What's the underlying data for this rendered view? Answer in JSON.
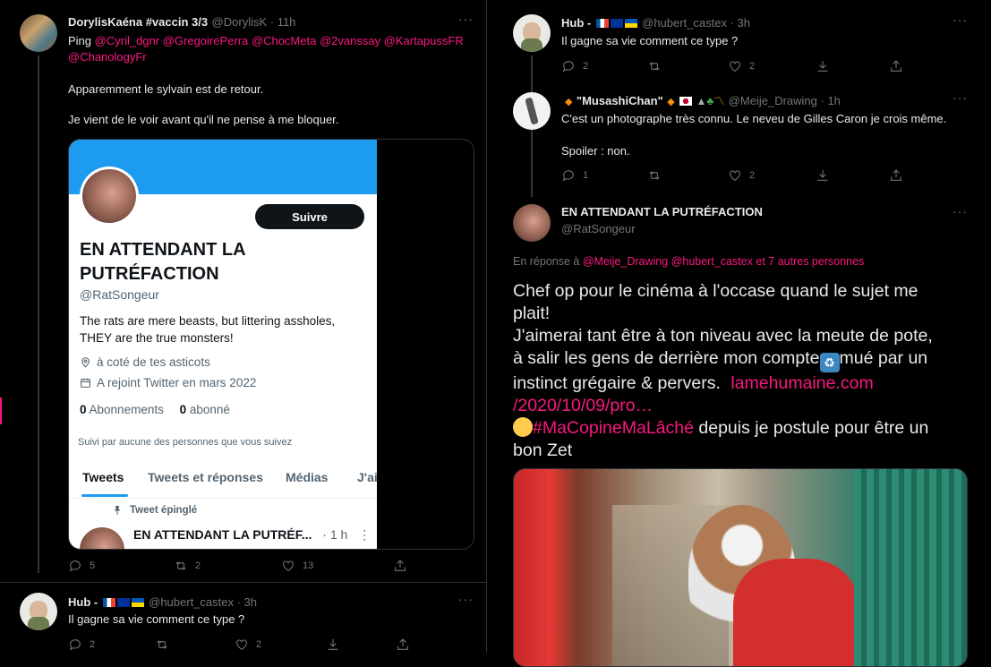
{
  "left": {
    "tweet1": {
      "name": "DorylisKaéna #vaccin 3/3",
      "handle": "@DorylisK · 11h",
      "ping": "Ping",
      "mentions1": "@Cyril_dgnr @GregoirePerra @ChocMeta @2vanssay @KartapussFR",
      "mentions2": "@ChanologyFr",
      "line1": "Apparemment le sylvain est de retour.",
      "line2": "Je vient de le voir avant qu'il ne pense à me bloquer.",
      "counts": {
        "reply": "5",
        "retweet": "2",
        "like": "13"
      }
    },
    "embed": {
      "follow_label": "Suivre",
      "profile_name_1": "EN ATTENDANT LA",
      "profile_name_2": "PUTRÉFACTION",
      "profile_handle": "@RatSongeur",
      "bio_1": "The rats are mere beasts, but littering assholes,",
      "bio_2": "THEY are the true monsters!",
      "location": "à coté de tes asticots",
      "joined": "A rejoint Twitter en mars 2022",
      "following_count": "0",
      "following_label": "Abonnements",
      "followers_count": "0",
      "followers_label": "abonné",
      "followed_by": "Suivi par aucune des personnes que vous suivez",
      "tabs": [
        "Tweets",
        "Tweets et réponses",
        "Médias",
        "J'ai"
      ],
      "pinned_label": "Tweet épinglé",
      "pinned_name": "EN ATTENDANT LA PUTRÉF...",
      "pinned_time": "· 1 h"
    },
    "tweet2": {
      "name": "Hub -",
      "handle": "@hubert_castex · 3h",
      "text": "Il gagne sa vie comment ce type ?",
      "counts": {
        "reply": "2",
        "like": "2"
      }
    }
  },
  "right": {
    "tweet1": {
      "name": "Hub -",
      "handle": "@hubert_castex · 3h",
      "text": "Il gagne sa vie comment ce type ?",
      "counts": {
        "reply": "2",
        "like": "2"
      }
    },
    "tweet2": {
      "name": "\"MusashiChan\"",
      "handle": "@Meije_Drawing · 1h",
      "line1": "C'est un photographe très connu. Le neveu de Gilles Caron je crois même.",
      "line2": "Spoiler : non.",
      "counts": {
        "reply": "1",
        "like": "2"
      }
    },
    "focus": {
      "name": "EN ATTENDANT LA PUTRÉFACTION",
      "handle": "@RatSongeur",
      "reply_prefix": "En réponse à",
      "reply_mentions": "@Meije_Drawing @hubert_castex",
      "reply_suffix": "et 7 autres personnes",
      "l1": "Chef op pour le cinéma à l'occase quand le sujet me",
      "l2": "plait!",
      "l3": "J'aimerai tant être à ton niveau avec la meute de pote,",
      "l4a": "à salir les gens de derrière mon compte",
      "l4b": "mué par un",
      "l5a": "instinct grégaire & pervers.",
      "l5link": "lamehumaine.com",
      "l6link": "/2020/10/09/pro…",
      "l7hashtag": "#MaCopineMaLâché",
      "l7b": "depuis je postule pour être un",
      "l8": "bon Zet"
    }
  },
  "colors": {
    "accent": "#f91880",
    "background": "#000000",
    "text": "#e7e9ea",
    "muted": "#71767b",
    "banner": "#1d9bf0"
  }
}
